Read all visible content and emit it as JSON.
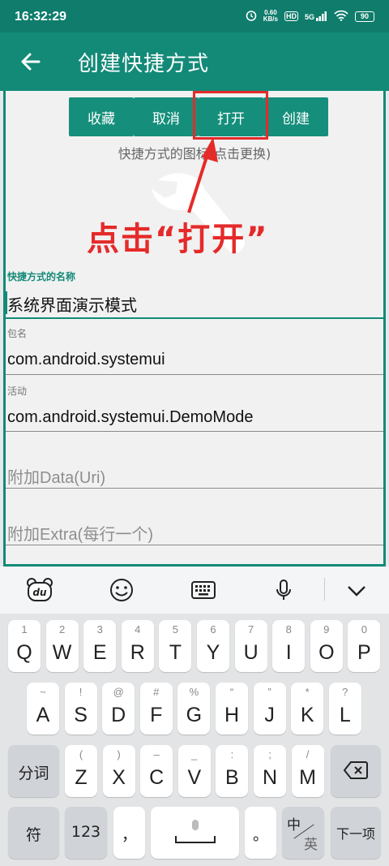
{
  "status": {
    "time": "16:32:29",
    "speed_top": "0.60",
    "speed_bottom": "KB/s",
    "hd": "HD",
    "net": "5G",
    "battery": "90"
  },
  "app_bar": {
    "title": "创建快捷方式"
  },
  "buttons": {
    "favorite": "收藏",
    "cancel": "取消",
    "open": "打开",
    "create": "创建"
  },
  "icon_hint": "快捷方式的图标(点击更换)",
  "annotation": "点击“打开”",
  "fields": {
    "name_label": "快捷方式的名称",
    "name_value": "系统界面演示模式",
    "package_label": "包名",
    "package_value": "com.android.systemui",
    "activity_label": "活动",
    "activity_value": "com.android.systemui.DemoMode",
    "data_placeholder": "附加Data(Uri)",
    "extra_placeholder": "附加Extra(每行一个)"
  },
  "keyboard": {
    "row1": [
      {
        "k": "Q",
        "s": "1"
      },
      {
        "k": "W",
        "s": "2"
      },
      {
        "k": "E",
        "s": "3"
      },
      {
        "k": "R",
        "s": "4"
      },
      {
        "k": "T",
        "s": "5"
      },
      {
        "k": "Y",
        "s": "6"
      },
      {
        "k": "U",
        "s": "7"
      },
      {
        "k": "I",
        "s": "8"
      },
      {
        "k": "O",
        "s": "9"
      },
      {
        "k": "P",
        "s": "0"
      }
    ],
    "row2": [
      {
        "k": "A",
        "s": "~"
      },
      {
        "k": "S",
        "s": "!"
      },
      {
        "k": "D",
        "s": "@"
      },
      {
        "k": "F",
        "s": "#"
      },
      {
        "k": "G",
        "s": "%"
      },
      {
        "k": "H",
        "s": "“"
      },
      {
        "k": "J",
        "s": "”"
      },
      {
        "k": "K",
        "s": "*"
      },
      {
        "k": "L",
        "s": "?"
      }
    ],
    "row3": [
      {
        "k": "Z",
        "s": "("
      },
      {
        "k": "X",
        "s": ")"
      },
      {
        "k": "C",
        "s": "–"
      },
      {
        "k": "V",
        "s": "_"
      },
      {
        "k": "B",
        "s": ":"
      },
      {
        "k": "N",
        "s": ";"
      },
      {
        "k": "M",
        "s": "/"
      }
    ],
    "segment_label": "分词",
    "symbol_label": "符",
    "num_label": "123",
    "comma_label": "，",
    "period_label": "。",
    "lang_zh": "中",
    "lang_en": "英",
    "next_label": "下一项"
  },
  "colors": {
    "primary": "#138a78",
    "status": "#0f7c6c",
    "accent_red": "#e52a2a"
  }
}
